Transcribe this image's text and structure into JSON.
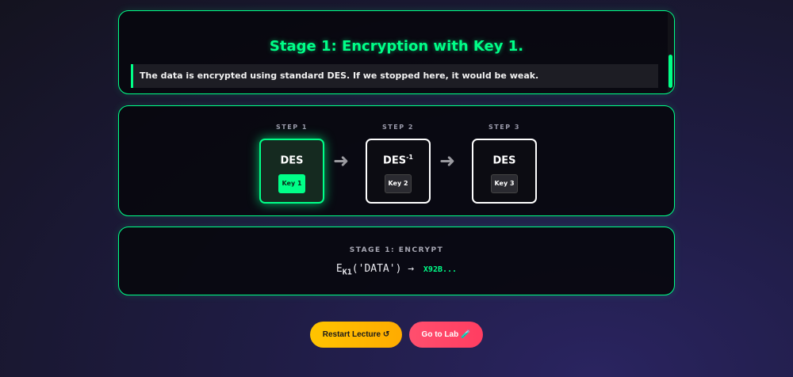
{
  "stage_panel": {
    "title": "Stage 1: Encryption with Key 1.",
    "description": "The data is encrypted using standard DES. If we stopped here, it would be weak."
  },
  "pipeline": {
    "steps": [
      {
        "label": "STEP 1",
        "name": "DES",
        "name_sup": "",
        "key": "Key 1",
        "active": true
      },
      {
        "label": "STEP 2",
        "name": "DES",
        "name_sup": "-1",
        "key": "Key 2",
        "active": false
      },
      {
        "label": "STEP 3",
        "name": "DES",
        "name_sup": "",
        "key": "Key 3",
        "active": false
      }
    ],
    "arrow_icon": "arrow-right-icon"
  },
  "formula_panel": {
    "label": "STAGE 1: ENCRYPT",
    "func": "E",
    "subscript": "K1",
    "argument": "('DATA')",
    "arrow": "→",
    "result": "X92B..."
  },
  "actions": {
    "restart_label": "Restart Lecture ↺",
    "lab_label": "Go to Lab 🧪"
  },
  "colors": {
    "accent": "#00ff88",
    "restart_button": "#ffc400",
    "lab_button": "#ff4f6e"
  }
}
